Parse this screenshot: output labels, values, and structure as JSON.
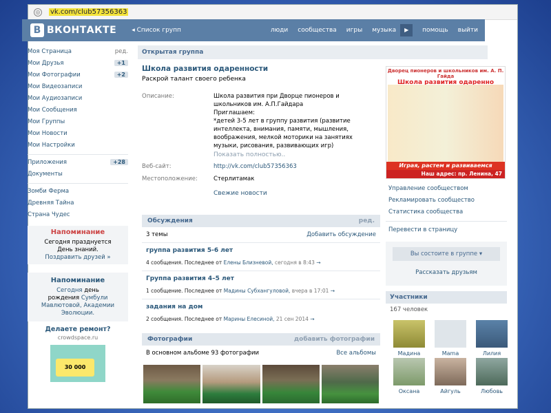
{
  "browser": {
    "url": "vk.com/club57356363"
  },
  "topbar": {
    "logo": "ВКОНТАКТЕ",
    "logo_letter": "В",
    "back": "◂ Список групп",
    "nav": [
      "люди",
      "сообщества",
      "игры",
      "музыка",
      "помощь",
      "выйти"
    ],
    "play": "▶"
  },
  "sidebar": {
    "items": [
      {
        "label": "Моя Страница",
        "extra": "ред."
      },
      {
        "label": "Мои Друзья",
        "extra": "+1"
      },
      {
        "label": "Мои Фотографии",
        "extra": "+2"
      },
      {
        "label": "Мои Видеозаписи",
        "extra": ""
      },
      {
        "label": "Мои Аудиозаписи",
        "extra": ""
      },
      {
        "label": "Мои Сообщения",
        "extra": ""
      },
      {
        "label": "Мои Группы",
        "extra": ""
      },
      {
        "label": "Мои Новости",
        "extra": ""
      },
      {
        "label": "Мои Настройки",
        "extra": ""
      }
    ],
    "apps": [
      {
        "label": "Приложения",
        "extra": "+28"
      },
      {
        "label": "Документы",
        "extra": ""
      }
    ],
    "games": [
      "Зомби Ферма",
      "Древняя Тайна",
      "Страна Чудес"
    ],
    "reminder1": {
      "title": "Напоминание",
      "text1": "Сегодня празднуется",
      "text2": "День знаний.",
      "link": "Поздравить друзей »"
    },
    "reminder2": {
      "title": "Напоминание",
      "text1": "Сегодня",
      "text2": "день",
      "text3": "рождения",
      "names": "Сумбули Мавлютовой, Академии Эволюции."
    },
    "ad": {
      "title": "Делаете ремонт?",
      "site": "crowdspace.ru",
      "card": "30 000"
    }
  },
  "group": {
    "header": "Открытая группа",
    "title": "Школа развития одаренности",
    "status": "Раскрой талант своего ребенка",
    "desc_label": "Описание:",
    "desc": [
      "Школа развития при Дворце пионеров и",
      "школьников им. А.П.Гайдара",
      "Приглашаем:",
      "*детей 3-5 лет в группу развития (развитие",
      "интеллекта, внимания, памяти, мышления,",
      "воображения, мелкой моторики на занятиях",
      "музыки, рисования, развивающих игр)"
    ],
    "more": "Показать полностью..",
    "site_label": "Веб-сайт:",
    "site": "http://vk.com/club57356363",
    "loc_label": "Местоположение:",
    "loc": "Стерлитамак",
    "news": "Свежие новости"
  },
  "discussions": {
    "title": "Обсуждения",
    "edit": "ред.",
    "count": "3 темы",
    "add": "Добавить обсуждение",
    "topics": [
      {
        "title": "группа развития 5-6 лет",
        "pre": "4 сообщения. Последнее от",
        "author": "Елены Близневой,",
        "date": "сегодня в 8:43",
        "arrow": "→"
      },
      {
        "title": "Группа развития 4–5 лет",
        "pre": "1 сообщение. Последнее от",
        "author": "Мадины Субхангуловой,",
        "date": "вчера в 17:01",
        "arrow": "→"
      },
      {
        "title": "задания на дом",
        "pre": "2 сообщения. Последнее от",
        "author": "Марины Елесиной,",
        "date": "21 сен 2014",
        "arrow": "→"
      }
    ]
  },
  "photos": {
    "title": "Фотографии",
    "add": "добавить фотографии",
    "count": "В основном альбоме 93 фотографии",
    "all": "Все альбомы"
  },
  "poster": {
    "top": "Дворец пионеров и школьников им. А. П. Гайда",
    "title": "Школа развития одаренно",
    "slogan": "Играя, растем и развиваемся",
    "address": "Наш адрес: пр. Ленина, 47"
  },
  "right": {
    "links": [
      "Управление сообществом",
      "Рекламировать сообщество",
      "Статистика сообщества"
    ],
    "translate": "Перевести в страницу",
    "member_state": "Вы состоите в группе",
    "invite": "Рассказать друзьям",
    "members_title": "Участники",
    "members_count": "167 человек",
    "members": [
      "Мадина",
      "Mama",
      "Лилия",
      "Оксана",
      "Айгуль",
      "Любовь"
    ]
  }
}
